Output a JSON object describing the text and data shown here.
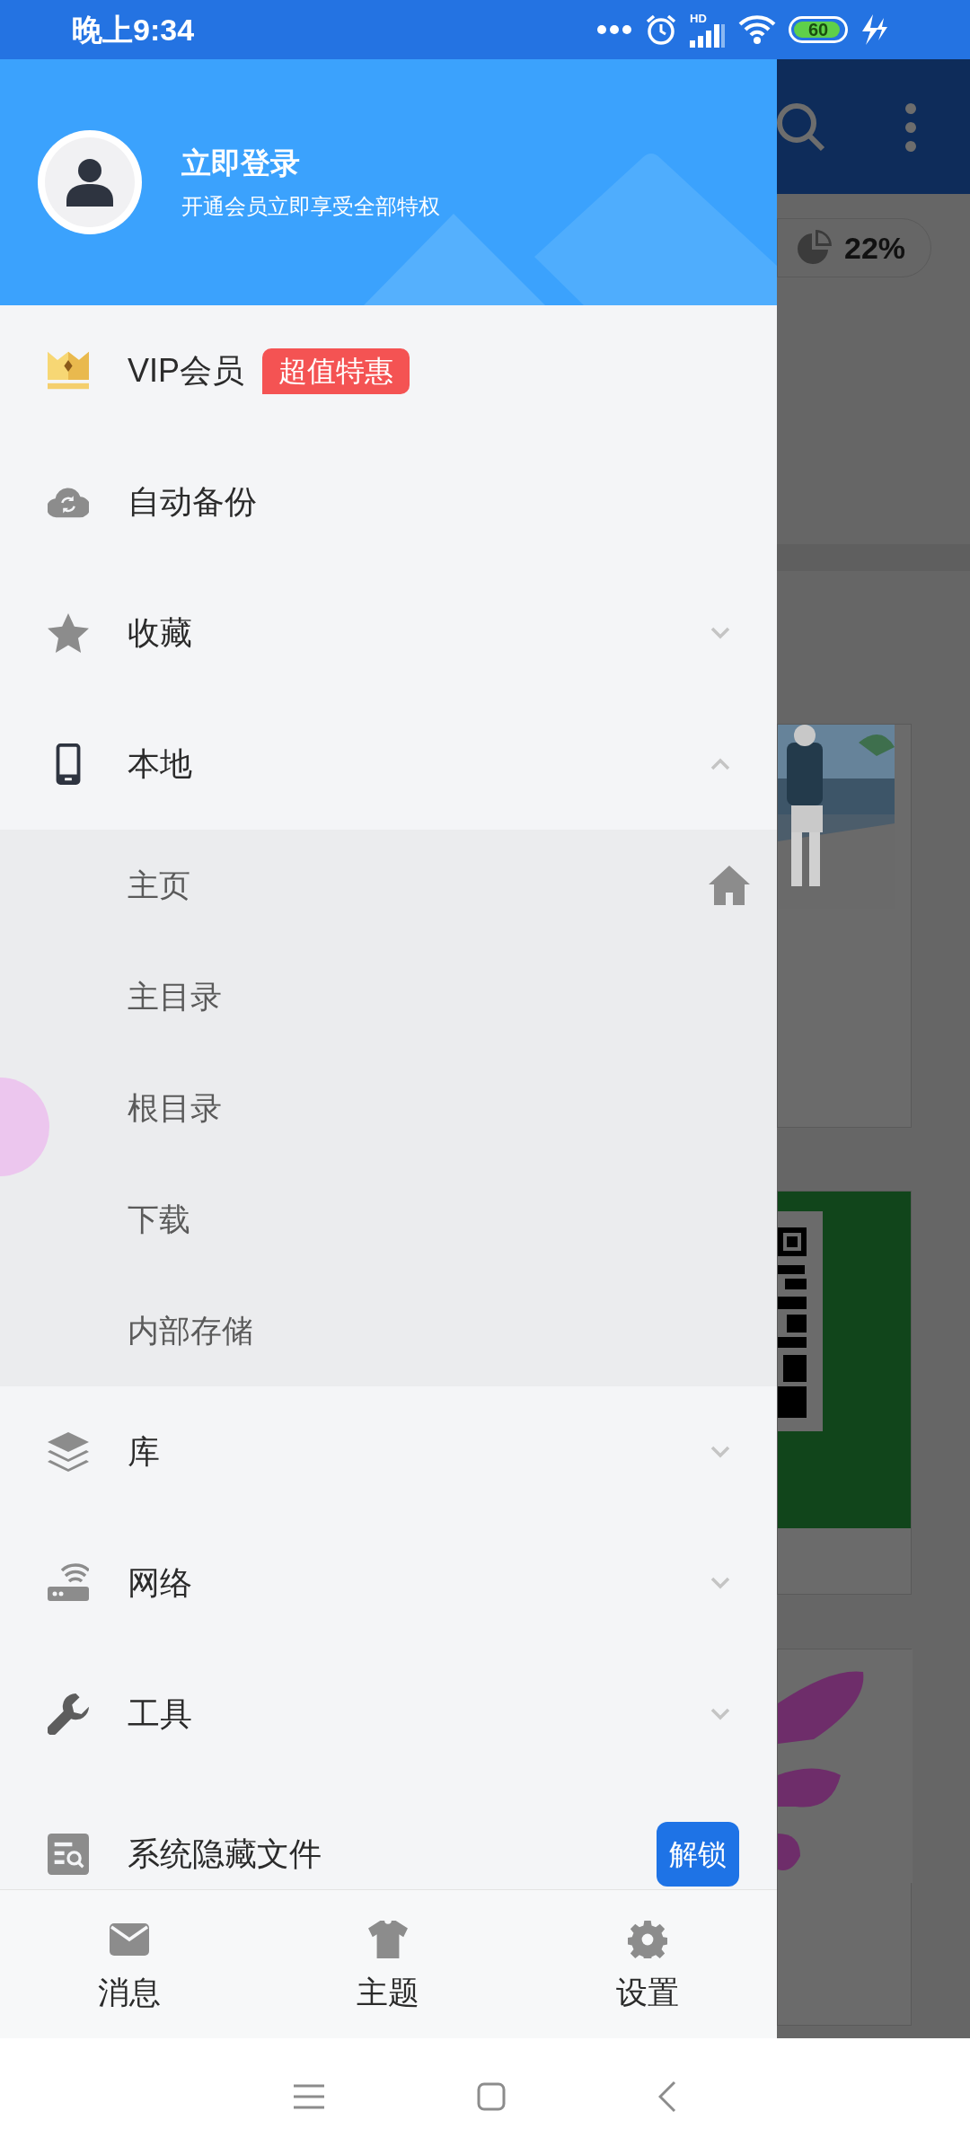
{
  "status_bar": {
    "time": "晚上9:34",
    "network": "HD",
    "battery": "60"
  },
  "drawer": {
    "header": {
      "title": "立即登录",
      "subtitle": "开通会员立即享受全部特权"
    },
    "menu": [
      {
        "kind": "badge",
        "label": "VIP会员",
        "badge": "超值特惠"
      },
      {
        "kind": "plain",
        "label": "自动备份"
      },
      {
        "kind": "group",
        "label": "收藏",
        "expanded": false
      },
      {
        "kind": "group",
        "label": "本地",
        "expanded": true,
        "children": [
          {
            "label": "主页",
            "home": true
          },
          {
            "label": "主目录",
            "home": false
          },
          {
            "label": "根目录",
            "home": false
          },
          {
            "label": "下载",
            "home": false
          },
          {
            "label": "内部存储",
            "home": false
          }
        ]
      },
      {
        "kind": "group",
        "label": "库",
        "expanded": false
      },
      {
        "kind": "group",
        "label": "网络",
        "expanded": false
      },
      {
        "kind": "group",
        "label": "工具",
        "expanded": false
      },
      {
        "kind": "action",
        "label": "系统隐藏文件",
        "button": "解锁"
      }
    ],
    "bottom_tabs": [
      {
        "label": "消息"
      },
      {
        "label": "主题"
      },
      {
        "label": "设置"
      }
    ]
  },
  "background": {
    "storage": "22%"
  }
}
